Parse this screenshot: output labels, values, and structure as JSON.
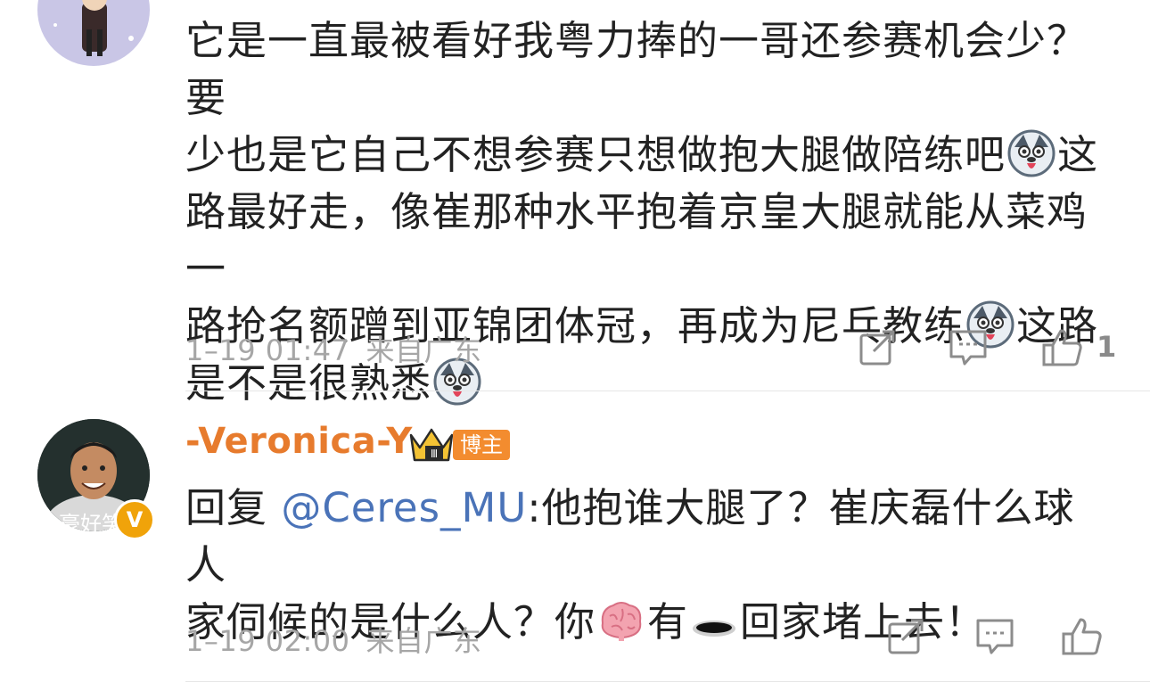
{
  "comments": [
    {
      "text_lines": [
        "它是一直最被看好我粤力捧的一哥还参赛机会少？要",
        "少也是它自己不想参赛只想做抱大腿做陪练吧",
        "路最好走，像崔那种水平抱着京皇大腿就能从菜鸡一",
        "路抢名额蹭到亚锦团体冠，再成为尼乓教练",
        "是不是很熟悉"
      ],
      "text_tail_1": "这",
      "text_tail_3": "这路",
      "time": "1–19 01:47",
      "location": "来自广东",
      "like_count": "1"
    },
    {
      "username": "-Veronica-Y",
      "badge": "博主",
      "avatar_caption": "豪好笑",
      "vip_mark": "V",
      "reply_prefix": "回复 ",
      "mention": "@Ceres_MU",
      "reply_text_1": ":他抱谁大腿了？崔庆磊什么球 人",
      "reply_text_2a": "家伺候的是什么人？你",
      "reply_text_2b": "有",
      "reply_text_2c": "回家堵上去！",
      "time": "1–19 02:00",
      "location": "来自广东",
      "like_count": ""
    }
  ],
  "icons": {
    "repost": "share-edit-icon",
    "comment": "comment-icon",
    "like": "thumbs-up-icon",
    "emoji_dog": "husky-emoji-icon",
    "emoji_brain": "brain-emoji-icon",
    "emoji_hole": "hole-emoji-icon",
    "crown": "crown-rank-icon"
  },
  "colors": {
    "username": "#e77b2d",
    "mention": "#4a73b8",
    "meta": "#a6a6a6",
    "badge": "#f38c2f"
  }
}
